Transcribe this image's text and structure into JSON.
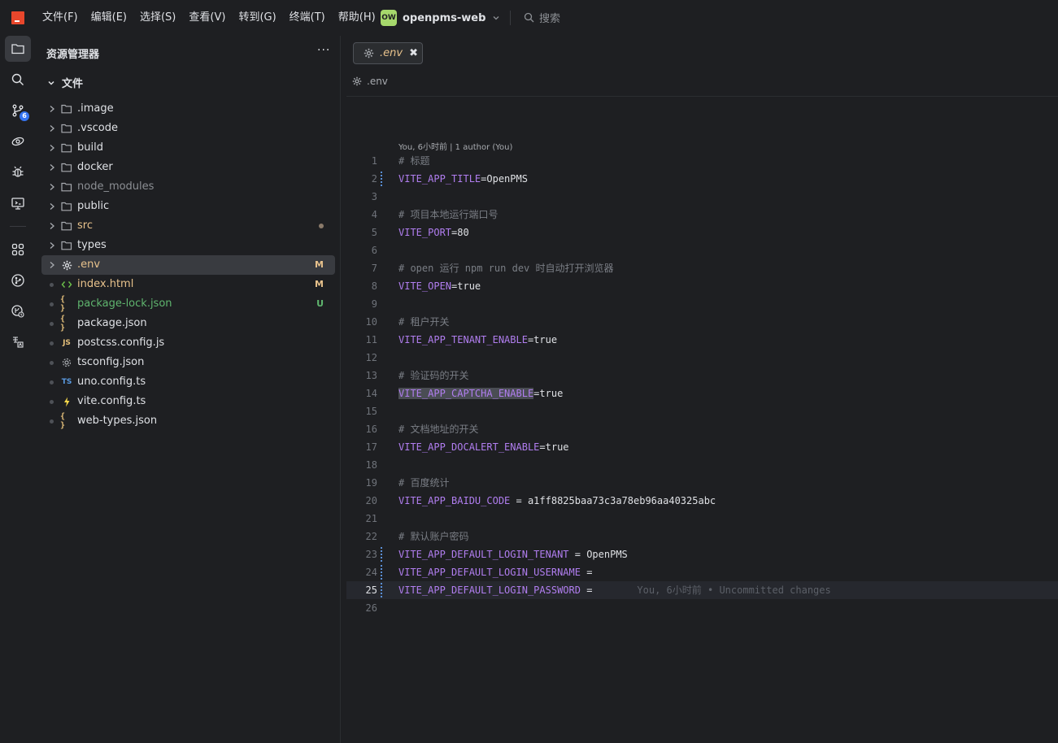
{
  "menu": {
    "items": [
      "文件(F)",
      "编辑(E)",
      "选择(S)",
      "查看(V)",
      "转到(G)",
      "终端(T)",
      "帮助(H)"
    ]
  },
  "project": {
    "badge": "OW",
    "name": "openpms-web"
  },
  "search": {
    "label": "搜索"
  },
  "activity": {
    "git_badge": "6"
  },
  "explorer": {
    "title": "资源管理器",
    "more": "···",
    "root": "文件",
    "items": [
      {
        "label": ".image",
        "kind": "folder",
        "color": "#dfe1e5",
        "status": ""
      },
      {
        "label": ".vscode",
        "kind": "folder",
        "color": "#dfe1e5",
        "status": ""
      },
      {
        "label": "build",
        "kind": "folder",
        "color": "#dfe1e5",
        "status": ""
      },
      {
        "label": "docker",
        "kind": "folder",
        "color": "#dfe1e5",
        "status": ""
      },
      {
        "label": "node_modules",
        "kind": "folder",
        "color": "#8c8f94",
        "status": ""
      },
      {
        "label": "public",
        "kind": "folder",
        "color": "#dfe1e5",
        "status": ""
      },
      {
        "label": "src",
        "kind": "folder",
        "color": "#e8c28c",
        "status": "dot"
      },
      {
        "label": "types",
        "kind": "folder",
        "color": "#dfe1e5",
        "status": ""
      },
      {
        "label": ".env",
        "kind": "env",
        "color": "#e8c28c",
        "status": "M"
      },
      {
        "label": "index.html",
        "kind": "html",
        "color": "#e8c28c",
        "status": "M"
      },
      {
        "label": "package-lock.json",
        "kind": "json",
        "color": "#5fb56e",
        "status": "U"
      },
      {
        "label": "package.json",
        "kind": "json",
        "color": "#dfe1e5",
        "status": ""
      },
      {
        "label": "postcss.config.js",
        "kind": "js",
        "color": "#dfe1e5",
        "status": ""
      },
      {
        "label": "tsconfig.json",
        "kind": "tsconfig",
        "color": "#dfe1e5",
        "status": ""
      },
      {
        "label": "uno.config.ts",
        "kind": "ts",
        "color": "#dfe1e5",
        "status": ""
      },
      {
        "label": "vite.config.ts",
        "kind": "vite",
        "color": "#dfe1e5",
        "status": ""
      },
      {
        "label": "web-types.json",
        "kind": "json",
        "color": "#dfe1e5",
        "status": ""
      }
    ]
  },
  "editor": {
    "tab_label": ".env",
    "tab_close": "✖",
    "breadcrumb": ".env",
    "blame_header": "You, 6小时前 | 1 author (You)",
    "inline_blame": "You, 6小时前 • Uncommitted changes",
    "lines": [
      {
        "n": "1",
        "type": "comment",
        "text": "# 标题"
      },
      {
        "n": "2",
        "type": "kv",
        "key": "VITE_APP_TITLE",
        "rest": "=OpenPMS",
        "mark": true
      },
      {
        "n": "3",
        "type": "empty"
      },
      {
        "n": "4",
        "type": "comment",
        "text": "# 项目本地运行端口号"
      },
      {
        "n": "5",
        "type": "kv",
        "key": "VITE_PORT",
        "rest": "=80"
      },
      {
        "n": "6",
        "type": "empty"
      },
      {
        "n": "7",
        "type": "comment",
        "text": "# open 运行 npm run dev 时自动打开浏览器"
      },
      {
        "n": "8",
        "type": "kv",
        "key": "VITE_OPEN",
        "rest": "=true"
      },
      {
        "n": "9",
        "type": "empty"
      },
      {
        "n": "10",
        "type": "comment",
        "text": "# 租户开关"
      },
      {
        "n": "11",
        "type": "kv",
        "key": "VITE_APP_TENANT_ENABLE",
        "rest": "=true"
      },
      {
        "n": "12",
        "type": "empty"
      },
      {
        "n": "13",
        "type": "comment",
        "text": "# 验证码的开关"
      },
      {
        "n": "14",
        "type": "kv",
        "key": "VITE_APP_CAPTCHA_ENABLE",
        "rest": "=true",
        "highlight": true
      },
      {
        "n": "15",
        "type": "empty"
      },
      {
        "n": "16",
        "type": "comment",
        "text": "# 文档地址的开关"
      },
      {
        "n": "17",
        "type": "kv",
        "key": "VITE_APP_DOCALERT_ENABLE",
        "rest": "=true"
      },
      {
        "n": "18",
        "type": "empty"
      },
      {
        "n": "19",
        "type": "comment",
        "text": "# 百度统计"
      },
      {
        "n": "20",
        "type": "kv",
        "key": "VITE_APP_BAIDU_CODE",
        "rest": " = a1ff8825baa73c3a78eb96aa40325abc"
      },
      {
        "n": "21",
        "type": "empty"
      },
      {
        "n": "22",
        "type": "comment",
        "text": "# 默认账户密码"
      },
      {
        "n": "23",
        "type": "kv",
        "key": "VITE_APP_DEFAULT_LOGIN_TENANT",
        "rest": " = OpenPMS",
        "mark": true
      },
      {
        "n": "24",
        "type": "kv",
        "key": "VITE_APP_DEFAULT_LOGIN_USERNAME",
        "rest": " =",
        "mark": true
      },
      {
        "n": "25",
        "type": "kv",
        "key": "VITE_APP_DEFAULT_LOGIN_PASSWORD",
        "rest": " =",
        "mark": true,
        "current": true
      },
      {
        "n": "26",
        "type": "empty"
      }
    ]
  },
  "colors": {
    "accent": "#3574f0",
    "modified": "#e8c28c",
    "untracked": "#5fb56e",
    "key": "#b17ef0",
    "comment": "#7a7e85"
  }
}
